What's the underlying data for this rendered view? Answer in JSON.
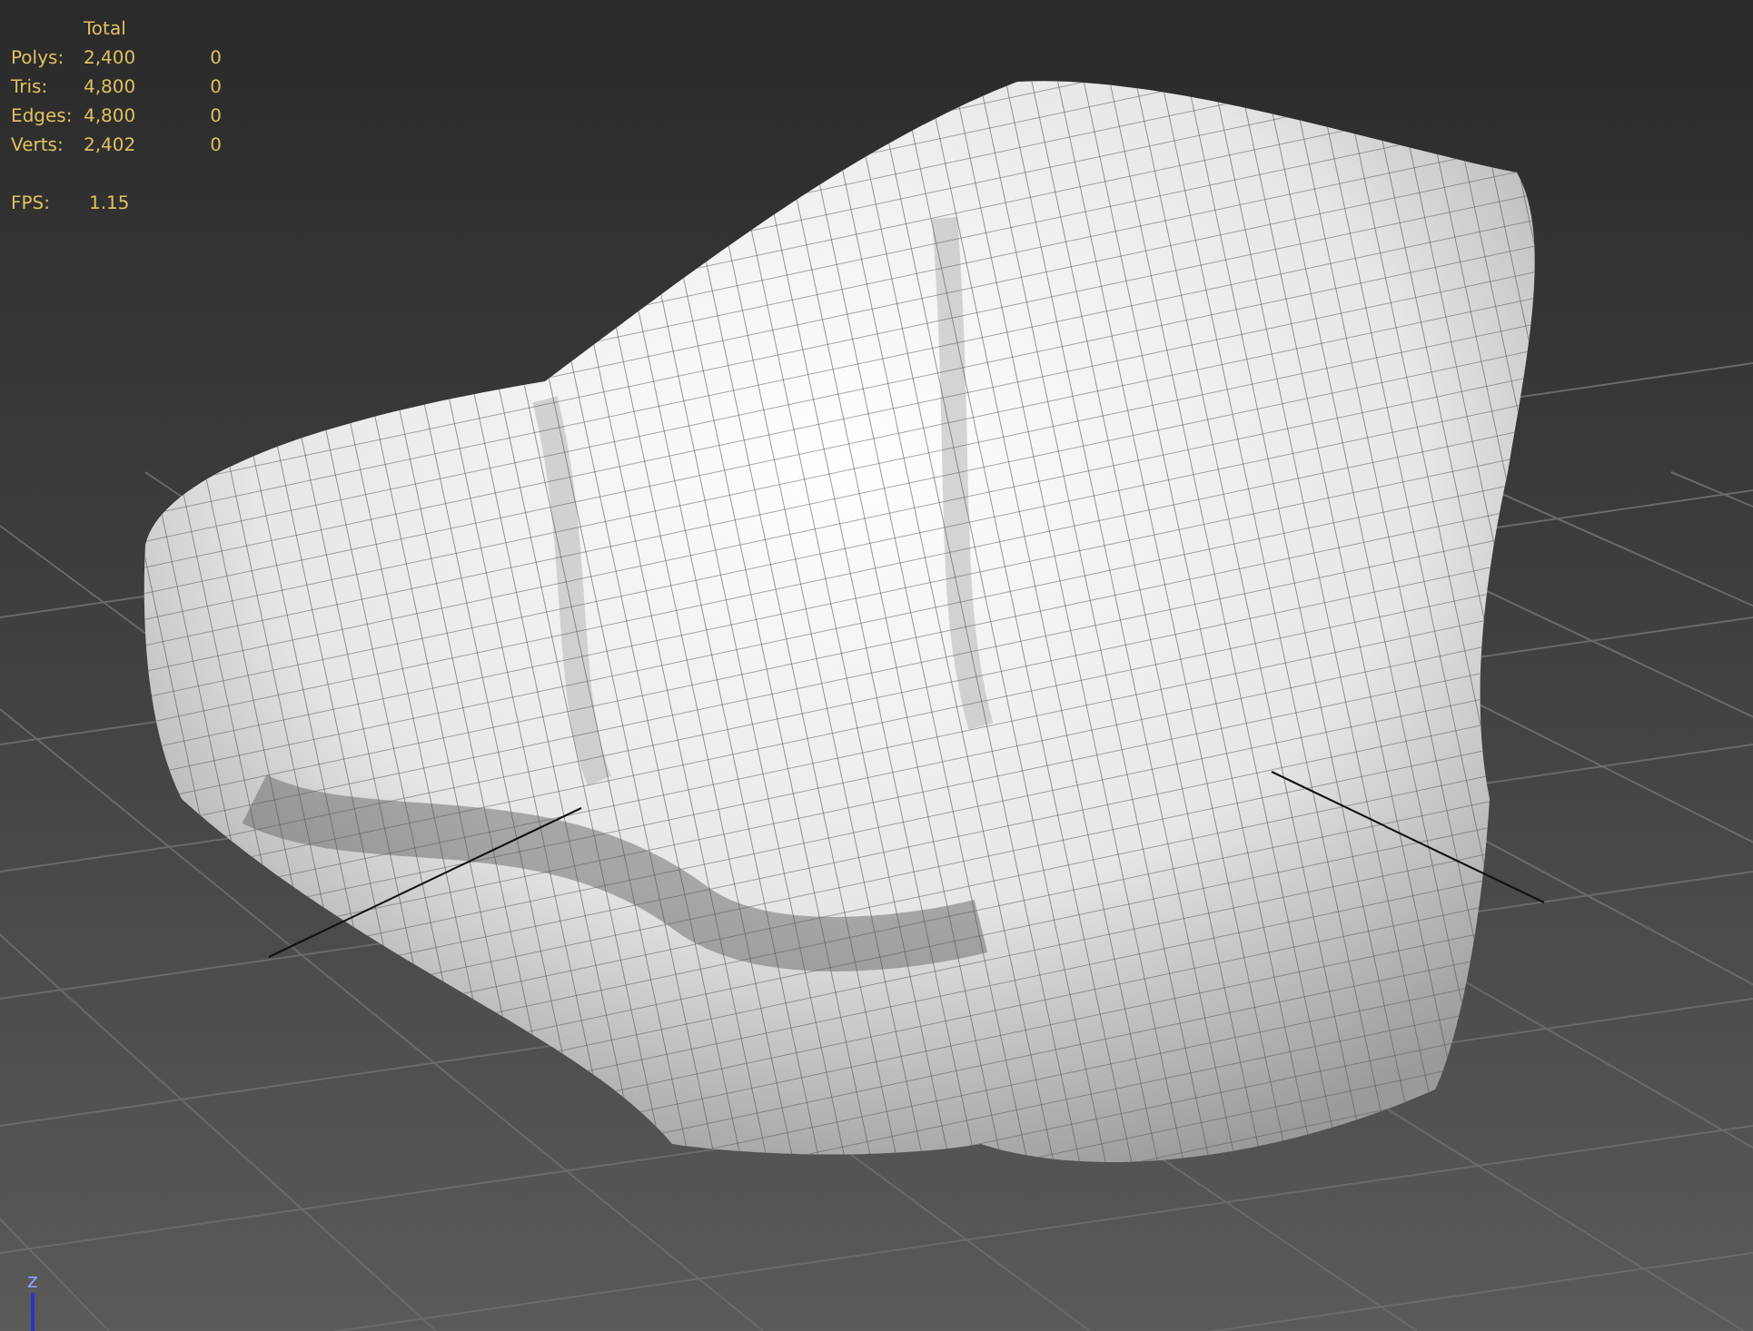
{
  "stats": {
    "header": "Total",
    "rows": [
      {
        "label": "Polys:",
        "total": "2,400",
        "selected": "0"
      },
      {
        "label": "Tris:",
        "total": "4,800",
        "selected": "0"
      },
      {
        "label": "Edges:",
        "total": "4,800",
        "selected": "0"
      },
      {
        "label": "Verts:",
        "total": "2,402",
        "selected": "0"
      }
    ],
    "fps": {
      "label": "FPS:",
      "value": "1.15"
    }
  },
  "axis": {
    "label": "z"
  }
}
